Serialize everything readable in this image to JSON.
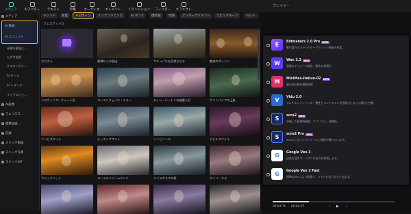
{
  "toolbar": {
    "items": [
      {
        "label": "メディア",
        "icon": "media-icon"
      },
      {
        "label": "AIアバター",
        "icon": "avatar-icon"
      },
      {
        "label": "テキスト",
        "icon": "text-icon"
      },
      {
        "label": "字幕",
        "icon": "subtitle-icon"
      },
      {
        "label": "オーディオ",
        "icon": "audio-icon"
      },
      {
        "label": "エレメント",
        "icon": "element-icon"
      },
      {
        "label": "トランジション",
        "icon": "transition-icon"
      },
      {
        "label": "フィルター",
        "icon": "filter-icon"
      },
      {
        "label": "エフェクト",
        "icon": "effect-icon"
      }
    ],
    "player_title": "プレイヤー"
  },
  "sidebar": {
    "media": "メディア",
    "group_title": "AI 動画",
    "group_sub": "AI エフェクト",
    "subs": [
      "画像を動画に...",
      "ビデオ拡張",
      "テキストから...",
      "AI ダンス",
      "AI トランジ...",
      "マイプロジェ..."
    ],
    "items": [
      "AI画像",
      "フェイスス...",
      "複数描画...",
      "記録",
      "ストック動画",
      "ストック写真",
      "ストックGIF"
    ]
  },
  "tabs": [
    "トレンド",
    "新着",
    "ハロウィン",
    "インテリジェンス",
    "AI ダンス",
    "爆笑劇",
    "体感",
    "エンターテイメント",
    "エピックモーフ",
    "ペット",
    "フェスティバル"
  ],
  "selected_tab": "ハロウィン",
  "cards": [
    "カスタム",
    "墓場からの脱出",
    "サキュバスを召喚させる",
    "魅惑のダーリン",
    "ハロウィンアーチャー人形",
    "ゴーストフェイス・キラー",
    "ティム・バートンの幽霊人形",
    "ヴァンパイアの王族",
    "ゾンビスタイル",
    "ビーストアサルト",
    "ゾンビハンタ",
    "デビルスマイル",
    "マジックハット",
    "コーラルドリームランド",
    "ミイラガラスの庵",
    "ボンバ・オラ",
    "",
    "",
    "",
    ""
  ],
  "models": [
    {
      "name": "Edimakers 2.0 Pro",
      "badge": "NEW",
      "desc": "動作実行とキャラクターアクション動画の充実。",
      "color": "#7a3cff",
      "glyph": "E"
    },
    {
      "name": "Wan 2.2",
      "badge": "NEW",
      "desc": "画像のディテール強化・動作の表現力",
      "color": "#5b3cff",
      "glyph": "W"
    },
    {
      "name": "MiniMax-Hailuo-02",
      "badge": "NEW",
      "desc": "最先端の動作理解技術",
      "color": "#e0306a",
      "glyph": "M"
    },
    {
      "name": "Vidu 2.0",
      "badge": "",
      "desc": "マルチエンティティの一貫性とコンテキスト学習能力において優れた性能",
      "color": "#2a6ad8",
      "glyph": "V"
    },
    {
      "name": "sora2",
      "badge": "NEW",
      "desc": "卓越した物理的精度、リアリズム、制御性。",
      "color": "#3a5ad8",
      "glyph": "S"
    },
    {
      "name": "sora2 Pro",
      "badge": "NEW",
      "desc": "Sora2と比べてディテールと質感が優れています。",
      "color": "#3a5ad8",
      "glyph": "S"
    },
    {
      "name": "Google Veo 3",
      "badge": "",
      "desc": "自然な音声で、リアルな出力を実現します。",
      "color": "#ffffff",
      "glyph": "G"
    },
    {
      "name": "Google Veo 3 Fast",
      "badge": "",
      "desc": "標準のVeo 3より高速で、コストも低く抑えられます。",
      "color": "#ffffff",
      "glyph": "G"
    }
  ],
  "playback": {
    "current": "00:04:15",
    "total": "00:04:27"
  }
}
